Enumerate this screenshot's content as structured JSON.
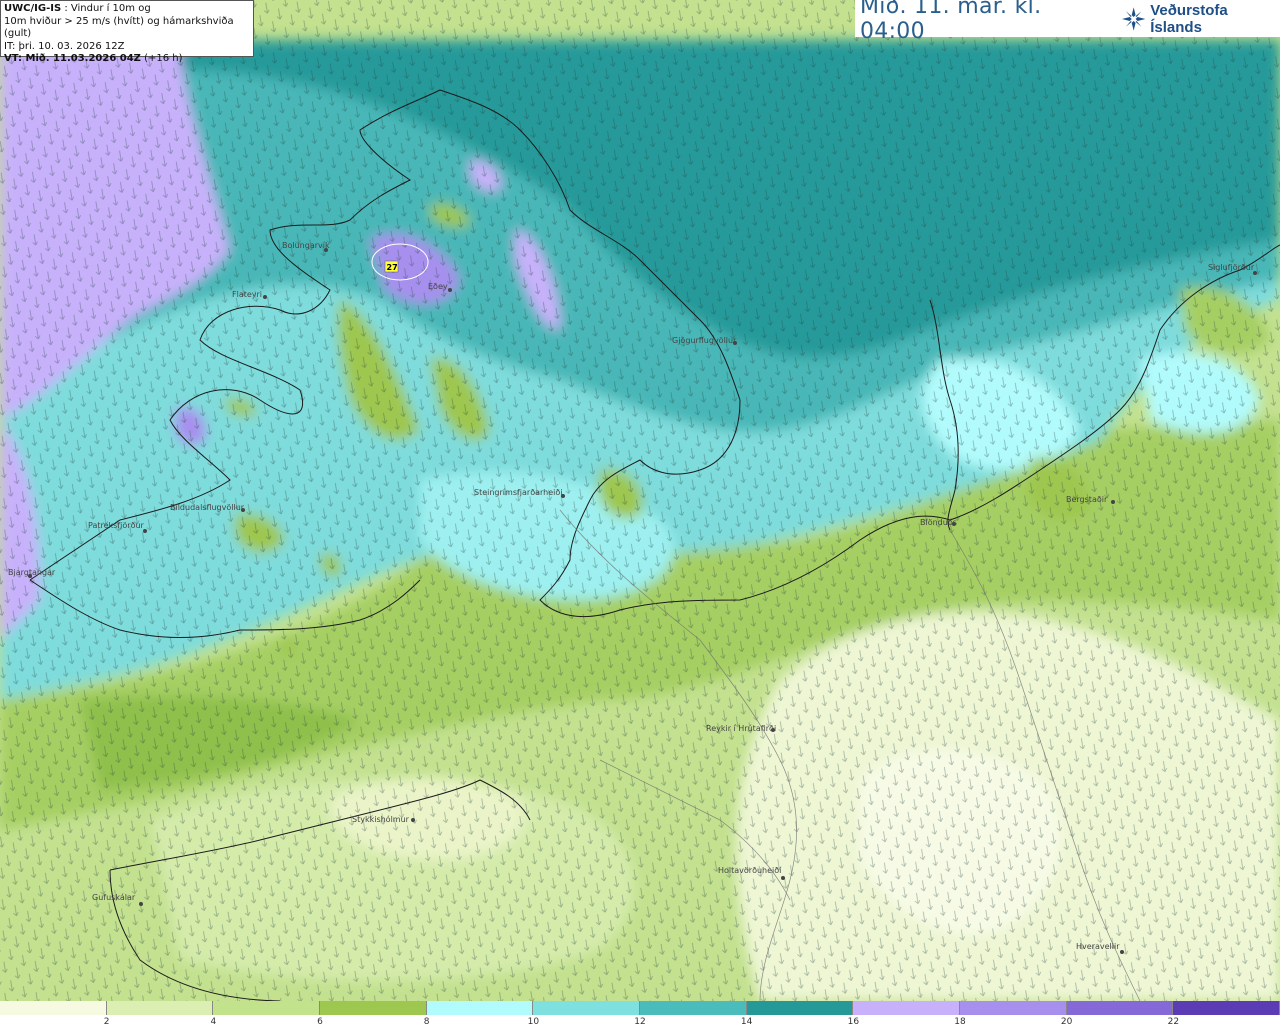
{
  "info": {
    "model": "UWC/IG-IS",
    "desc1": ": Vindur í 10m og",
    "desc2": "10m hviður > 25 m/s (hvítt) og hámarkshviða (gult)",
    "it_line": "IT: þri. 10. 03. 2026 12Z",
    "vt_label": "VT: Mið. 11.03.2026 04Z",
    "vt_offset": "(+16 h)"
  },
  "time_title": "Mið. 11. mar. kl. 04:00",
  "logo_text": "Veðurstofa Íslands",
  "icons": [
    "vedurstofa-logo-icon",
    "wind-arrow-icon",
    "station-dot-icon"
  ],
  "places": [
    {
      "name": "Bolungarvík"
    },
    {
      "name": "Flateyri"
    },
    {
      "name": "Eðey"
    },
    {
      "name": "Gjögurflugvöllur"
    },
    {
      "name": "Siglufjörður"
    },
    {
      "name": "Bergstaðir"
    },
    {
      "name": "Blönduós"
    },
    {
      "name": "Steingrímsfjarðarheiði"
    },
    {
      "name": "Bíldudalsflugvöllur"
    },
    {
      "name": "Patreksfjörður"
    },
    {
      "name": "Bjargtangar"
    },
    {
      "name": "Reykir í Hrútafirði"
    },
    {
      "name": "Stykkishólmur"
    },
    {
      "name": "Holtavörðuheiði"
    },
    {
      "name": "Gufuskálar"
    },
    {
      "name": "Hveravellir"
    }
  ],
  "max_gust": {
    "value": "27"
  },
  "legend": {
    "colors": [
      "#f5fae0",
      "#dcefb3",
      "#c2e28c",
      "#9ec750",
      "#b2fbfc",
      "#7fe0e0",
      "#4bbcbc",
      "#259898",
      "#c8b1fb",
      "#a78fee",
      "#8569d8",
      "#5c3cb5"
    ],
    "ticks": [
      "2",
      "4",
      "6",
      "8",
      "10",
      "12",
      "14",
      "16",
      "18",
      "20",
      "22"
    ]
  }
}
